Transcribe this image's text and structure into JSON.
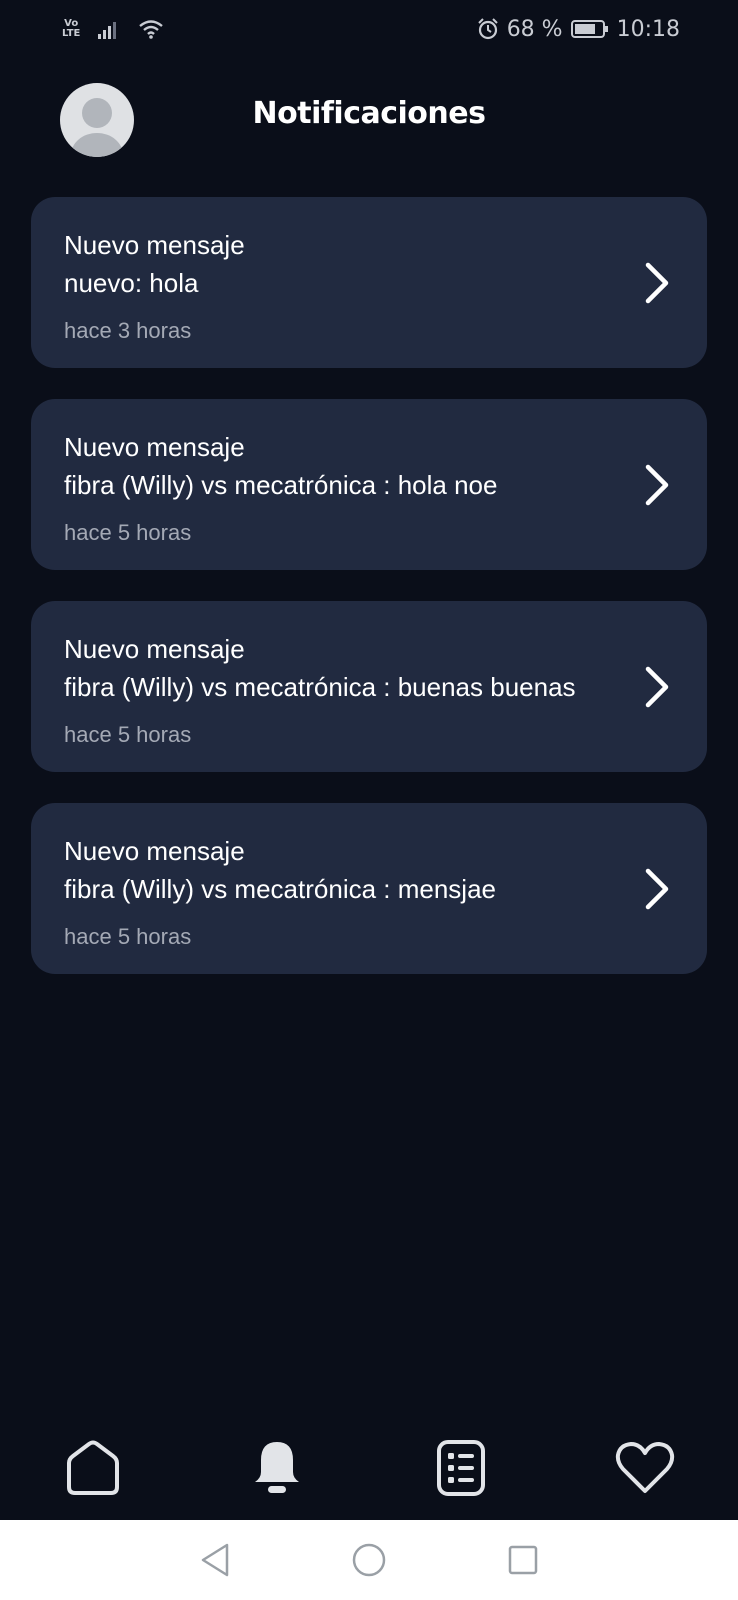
{
  "status_bar": {
    "network_label": "Vo\nLTE",
    "battery": "68 %",
    "time": "10:18",
    "icons": [
      "volte-icon",
      "signal-icon",
      "wifi-icon",
      "alarm-icon",
      "battery-icon"
    ]
  },
  "header": {
    "title": "Notificaciones",
    "avatar_icon": "avatar-placeholder-icon"
  },
  "notifications": [
    {
      "title": "Nuevo mensaje",
      "body": "nuevo: hola",
      "time": "hace 3 horas"
    },
    {
      "title": "Nuevo mensaje",
      "body": "fibra (Willy) vs mecatrónica : hola noe",
      "time": "hace 5 horas"
    },
    {
      "title": "Nuevo mensaje",
      "body": "fibra (Willy) vs mecatrónica : buenas buenas",
      "time": "hace 5 horas"
    },
    {
      "title": "Nuevo mensaje",
      "body": "fibra (Willy) vs mecatrónica : mensjae",
      "time": "hace 5 horas"
    }
  ],
  "bottom_nav": {
    "items": [
      "home-icon",
      "bell-icon",
      "list-icon",
      "heart-icon"
    ],
    "active": "bell-icon"
  },
  "system_nav": {
    "items": [
      "back-icon",
      "home-circle-icon",
      "recents-icon"
    ]
  },
  "colors": {
    "background": "#0a0e19",
    "card": "#212a40",
    "text": "#ffffff",
    "muted": "#a4a9b5"
  }
}
